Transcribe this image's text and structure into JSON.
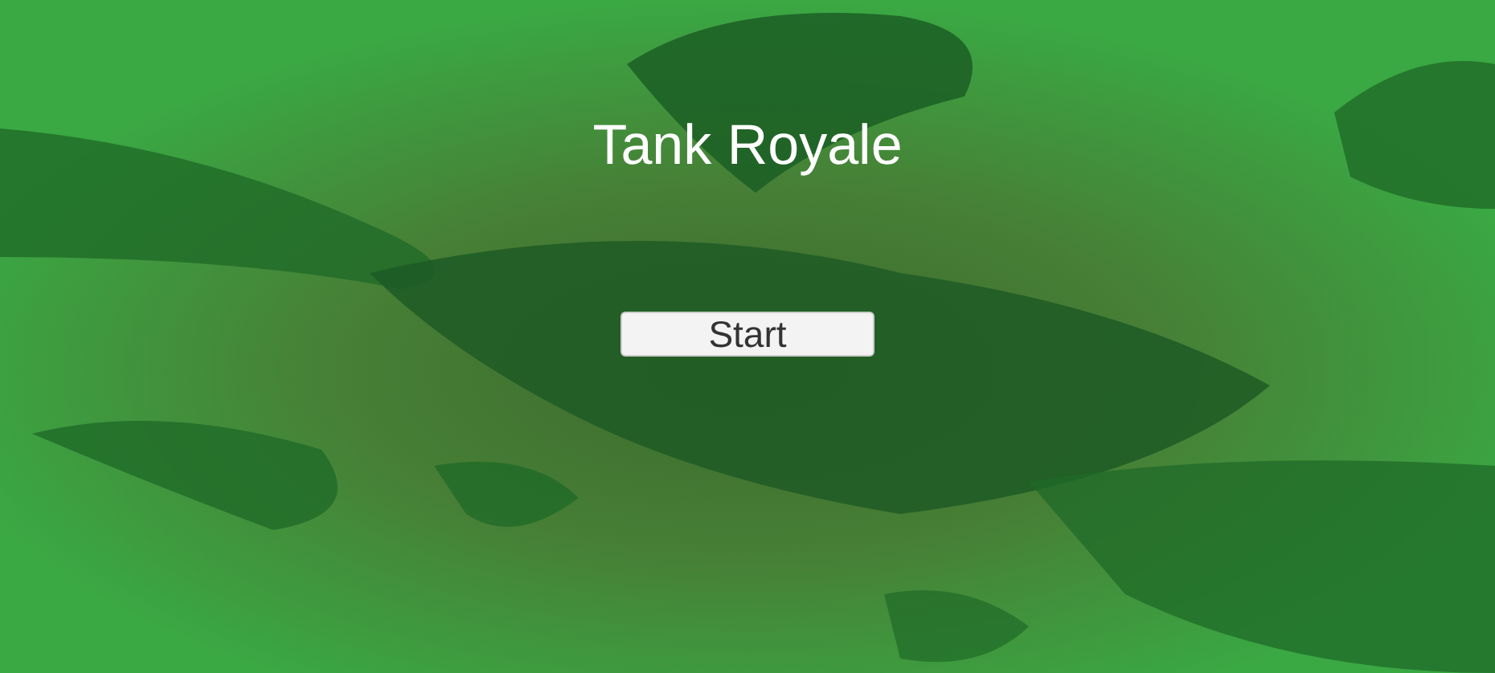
{
  "title": "Tank Royale",
  "buttons": [
    {
      "label": "Start"
    }
  ]
}
